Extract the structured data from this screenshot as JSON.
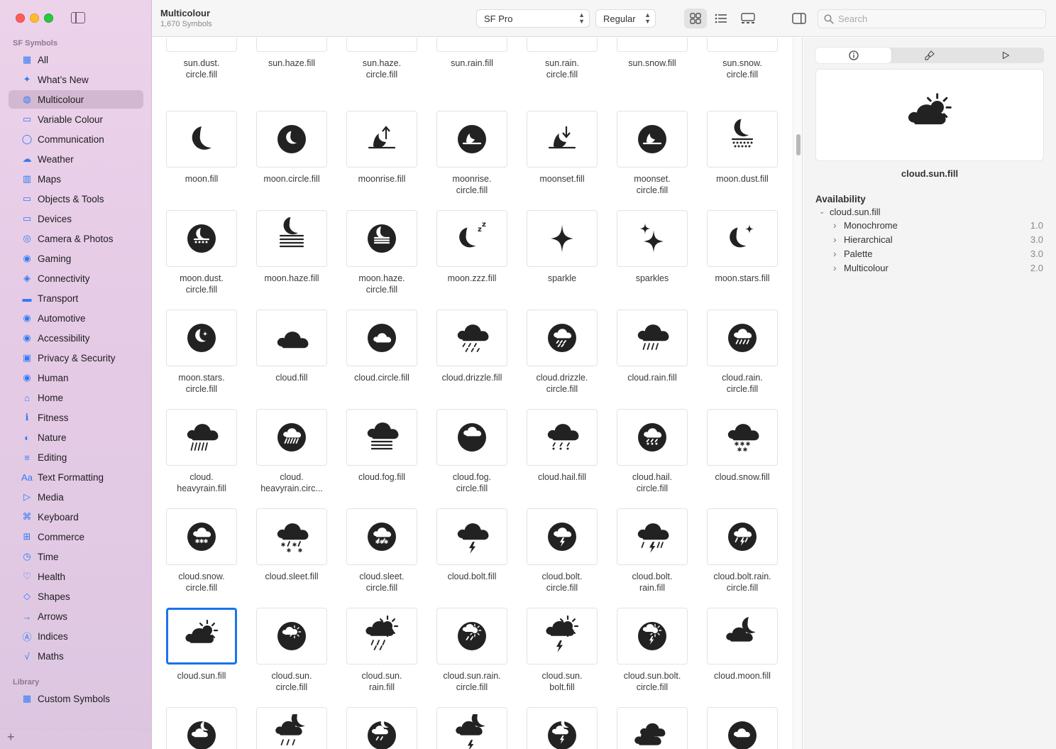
{
  "sidebar": {
    "section_title": "SF Symbols",
    "library_title": "Library",
    "items": [
      {
        "label": "All",
        "icon": "grid-icon",
        "selected": false
      },
      {
        "label": "What’s New",
        "icon": "sparkle-icon",
        "selected": false
      },
      {
        "label": "Multicolour",
        "icon": "palette-icon",
        "selected": true
      },
      {
        "label": "Variable Colour",
        "icon": "slider-icon",
        "selected": false
      },
      {
        "label": "Communication",
        "icon": "speech-bubble-icon",
        "selected": false
      },
      {
        "label": "Weather",
        "icon": "cloud-sun-icon",
        "selected": false
      },
      {
        "label": "Maps",
        "icon": "map-icon",
        "selected": false
      },
      {
        "label": "Objects & Tools",
        "icon": "folder-icon",
        "selected": false
      },
      {
        "label": "Devices",
        "icon": "desktop-icon",
        "selected": false
      },
      {
        "label": "Camera & Photos",
        "icon": "camera-icon",
        "selected": false
      },
      {
        "label": "Gaming",
        "icon": "gamecontroller-icon",
        "selected": false
      },
      {
        "label": "Connectivity",
        "icon": "antenna-icon",
        "selected": false
      },
      {
        "label": "Transport",
        "icon": "car-icon",
        "selected": false
      },
      {
        "label": "Automotive",
        "icon": "steering-wheel-icon",
        "selected": false
      },
      {
        "label": "Accessibility",
        "icon": "accessibility-icon",
        "selected": false
      },
      {
        "label": "Privacy & Security",
        "icon": "lock-icon",
        "selected": false
      },
      {
        "label": "Human",
        "icon": "person-icon",
        "selected": false
      },
      {
        "label": "Home",
        "icon": "house-icon",
        "selected": false
      },
      {
        "label": "Fitness",
        "icon": "figure-run-icon",
        "selected": false
      },
      {
        "label": "Nature",
        "icon": "leaf-icon",
        "selected": false
      },
      {
        "label": "Editing",
        "icon": "sliders-icon",
        "selected": false
      },
      {
        "label": "Text Formatting",
        "icon": "textformat-icon",
        "selected": false
      },
      {
        "label": "Media",
        "icon": "playpause-icon",
        "selected": false
      },
      {
        "label": "Keyboard",
        "icon": "command-icon",
        "selected": false
      },
      {
        "label": "Commerce",
        "icon": "cart-icon",
        "selected": false
      },
      {
        "label": "Time",
        "icon": "clock-icon",
        "selected": false
      },
      {
        "label": "Health",
        "icon": "heart-icon",
        "selected": false
      },
      {
        "label": "Shapes",
        "icon": "shapes-icon",
        "selected": false
      },
      {
        "label": "Arrows",
        "icon": "arrow-right-icon",
        "selected": false
      },
      {
        "label": "Indices",
        "icon": "a-circle-icon",
        "selected": false
      },
      {
        "label": "Maths",
        "icon": "function-icon",
        "selected": false
      }
    ],
    "library_items": [
      {
        "label": "Custom Symbols",
        "icon": "grid-icon"
      }
    ]
  },
  "toolbar": {
    "title": "Multicolour",
    "subtitle": "1,670 Symbols",
    "font_select": "SF Pro",
    "weight_select": "Regular",
    "search_placeholder": "Search"
  },
  "grid": {
    "rows": [
      [
        {
          "name": "sun.dust.\ncircle.fill",
          "icon": "sun-dust-circle",
          "circle": true
        },
        {
          "name": "sun.haze.fill",
          "icon": "sun-haze",
          "circle": false
        },
        {
          "name": "sun.haze.\ncircle.fill",
          "icon": "sun-haze-circle",
          "circle": true
        },
        {
          "name": "sun.rain.fill",
          "icon": "sun-rain",
          "circle": false
        },
        {
          "name": "sun.rain.\ncircle.fill",
          "icon": "sun-rain-circle",
          "circle": true
        },
        {
          "name": "sun.snow.fill",
          "icon": "sun-snow",
          "circle": false
        },
        {
          "name": "sun.snow.\ncircle.fill",
          "icon": "sun-snow-circle",
          "circle": true
        }
      ],
      [
        {
          "name": "moon.fill",
          "icon": "moon",
          "circle": false
        },
        {
          "name": "moon.circle.fill",
          "icon": "moon-circle",
          "circle": true
        },
        {
          "name": "moonrise.fill",
          "icon": "moonrise",
          "circle": false
        },
        {
          "name": "moonrise.\ncircle.fill",
          "icon": "moonrise-circle",
          "circle": true
        },
        {
          "name": "moonset.fill",
          "icon": "moonset",
          "circle": false
        },
        {
          "name": "moonset.\ncircle.fill",
          "icon": "moonset-circle",
          "circle": true
        },
        {
          "name": "moon.dust.fill",
          "icon": "moon-dust",
          "circle": false
        }
      ],
      [
        {
          "name": "moon.dust.\ncircle.fill",
          "icon": "moon-dust-circle",
          "circle": true
        },
        {
          "name": "moon.haze.fill",
          "icon": "moon-haze",
          "circle": false
        },
        {
          "name": "moon.haze.\ncircle.fill",
          "icon": "moon-haze-circle",
          "circle": true
        },
        {
          "name": "moon.zzz.fill",
          "icon": "moon-zzz",
          "circle": false
        },
        {
          "name": "sparkle",
          "icon": "sparkle",
          "circle": false
        },
        {
          "name": "sparkles",
          "icon": "sparkles",
          "circle": false
        },
        {
          "name": "moon.stars.fill",
          "icon": "moon-stars",
          "circle": false
        }
      ],
      [
        {
          "name": "moon.stars.\ncircle.fill",
          "icon": "moon-stars-circle",
          "circle": true
        },
        {
          "name": "cloud.fill",
          "icon": "cloud",
          "circle": false
        },
        {
          "name": "cloud.circle.fill",
          "icon": "cloud-circle",
          "circle": true
        },
        {
          "name": "cloud.drizzle.fill",
          "icon": "cloud-drizzle",
          "circle": false
        },
        {
          "name": "cloud.drizzle.\ncircle.fill",
          "icon": "cloud-drizzle-circle",
          "circle": true
        },
        {
          "name": "cloud.rain.fill",
          "icon": "cloud-rain",
          "circle": false
        },
        {
          "name": "cloud.rain.\ncircle.fill",
          "icon": "cloud-rain-circle",
          "circle": true
        }
      ],
      [
        {
          "name": "cloud.\nheavyrain.fill",
          "icon": "cloud-heavyrain",
          "circle": false
        },
        {
          "name": "cloud.\nheavyrain.circ...",
          "icon": "cloud-heavyrain-circle",
          "circle": true
        },
        {
          "name": "cloud.fog.fill",
          "icon": "cloud-fog",
          "circle": false
        },
        {
          "name": "cloud.fog.\ncircle.fill",
          "icon": "cloud-fog-circle",
          "circle": true
        },
        {
          "name": "cloud.hail.fill",
          "icon": "cloud-hail",
          "circle": false
        },
        {
          "name": "cloud.hail.\ncircle.fill",
          "icon": "cloud-hail-circle",
          "circle": true
        },
        {
          "name": "cloud.snow.fill",
          "icon": "cloud-snow",
          "circle": false
        }
      ],
      [
        {
          "name": "cloud.snow.\ncircle.fill",
          "icon": "cloud-snow-circle",
          "circle": true
        },
        {
          "name": "cloud.sleet.fill",
          "icon": "cloud-sleet",
          "circle": false
        },
        {
          "name": "cloud.sleet.\ncircle.fill",
          "icon": "cloud-sleet-circle",
          "circle": true
        },
        {
          "name": "cloud.bolt.fill",
          "icon": "cloud-bolt",
          "circle": false
        },
        {
          "name": "cloud.bolt.\ncircle.fill",
          "icon": "cloud-bolt-circle",
          "circle": true
        },
        {
          "name": "cloud.bolt.\nrain.fill",
          "icon": "cloud-bolt-rain",
          "circle": false
        },
        {
          "name": "cloud.bolt.rain.\ncircle.fill",
          "icon": "cloud-bolt-rain-circle",
          "circle": true
        }
      ],
      [
        {
          "name": "cloud.sun.fill",
          "icon": "cloud-sun",
          "circle": false,
          "selected": true
        },
        {
          "name": "cloud.sun.\ncircle.fill",
          "icon": "cloud-sun-circle",
          "circle": true
        },
        {
          "name": "cloud.sun.\nrain.fill",
          "icon": "cloud-sun-rain",
          "circle": false
        },
        {
          "name": "cloud.sun.rain.\ncircle.fill",
          "icon": "cloud-sun-rain-circle",
          "circle": true
        },
        {
          "name": "cloud.sun.\nbolt.fill",
          "icon": "cloud-sun-bolt",
          "circle": false
        },
        {
          "name": "cloud.sun.bolt.\ncircle.fill",
          "icon": "cloud-sun-bolt-circle",
          "circle": true
        },
        {
          "name": "cloud.moon.fill",
          "icon": "cloud-moon",
          "circle": false
        }
      ],
      [
        {
          "name": "",
          "icon": "cloud-moon-circle",
          "circle": true
        },
        {
          "name": "",
          "icon": "cloud-moon-rain",
          "circle": false
        },
        {
          "name": "",
          "icon": "cloud-moon-rain-circle",
          "circle": true
        },
        {
          "name": "",
          "icon": "cloud-moon-bolt",
          "circle": false
        },
        {
          "name": "",
          "icon": "cloud-moon-bolt-circle",
          "circle": true
        },
        {
          "name": "",
          "icon": "smoke",
          "circle": false
        },
        {
          "name": "",
          "icon": "smoke-circle",
          "circle": true
        }
      ]
    ]
  },
  "inspector": {
    "tabs": [
      {
        "icon": "info-icon"
      },
      {
        "icon": "paintbrush-icon"
      },
      {
        "icon": "play-icon"
      }
    ],
    "preview_name": "cloud.sun.fill",
    "availability_title": "Availability",
    "tree_root": "cloud.sun.fill",
    "modes": [
      {
        "label": "Monochrome",
        "version": "1.0"
      },
      {
        "label": "Hierarchical",
        "version": "3.0"
      },
      {
        "label": "Palette",
        "version": "3.0"
      },
      {
        "label": "Multicolour",
        "version": "2.0"
      }
    ]
  },
  "colors": {
    "accent": "#1a74e8",
    "sidebar_icon": "#2f7cf6",
    "glyph": "#222222"
  }
}
